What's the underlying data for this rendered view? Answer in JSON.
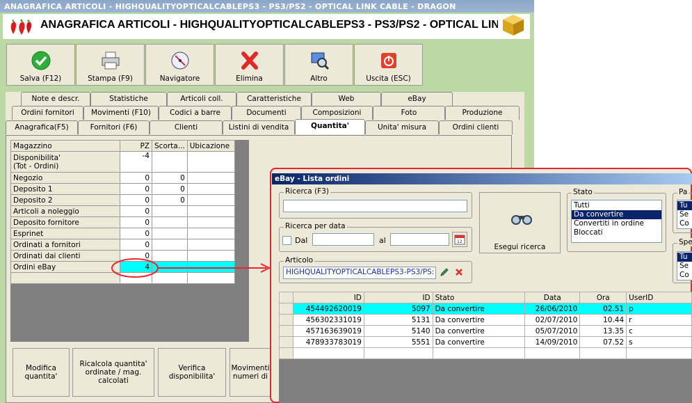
{
  "window": {
    "title": "ANAGRAFICA ARTICOLI - HIGHQUALITYOPTICALCABLEPS3 - PS3/PS2 - OPTICAL LINK CABLE - DRAGON",
    "header": "ANAGRAFICA ARTICOLI - HIGHQUALITYOPTICALCABLEPS3 - PS3/PS2 - OPTICAL LIN"
  },
  "toolbar": [
    {
      "label": "Salva (F12)",
      "icon": "check-icon"
    },
    {
      "label": "Stampa (F9)",
      "icon": "printer-icon"
    },
    {
      "label": "Navigatore",
      "icon": "compass-icon"
    },
    {
      "label": "Elimina",
      "icon": "delete-icon"
    },
    {
      "label": "Altro",
      "icon": "magnifier-icon"
    },
    {
      "label": "Uscita (ESC)",
      "icon": "power-icon"
    }
  ],
  "tabs": {
    "row1": [
      "Note e descr.",
      "Statistiche",
      "Articoli coll.",
      "Caratteristiche",
      "Web",
      "eBay"
    ],
    "row2": [
      "Ordini fornitori",
      "Movimenti (F10)",
      "Codici a barre",
      "Documenti",
      "Composizioni",
      "Foto",
      "Produzione"
    ],
    "row3": [
      "Anagrafica(F5)",
      "Fornitori (F6)",
      "Clienti",
      "Listini di vendita",
      "Quantita'",
      "Unita' misura",
      "Ordini clienti"
    ]
  },
  "stock_grid": {
    "headers": [
      "Magazzino",
      "PZ",
      "Scorta...",
      "Ubicazione"
    ],
    "rows": [
      {
        "label": "Disponibilita'\n(Tot - Ordini)",
        "pz": "-4",
        "scorta": ""
      },
      {
        "label": "Negozio",
        "pz": "0",
        "scorta": "0"
      },
      {
        "label": "Deposito 1",
        "pz": "0",
        "scorta": "0"
      },
      {
        "label": "Deposito 2",
        "pz": "0",
        "scorta": "0"
      },
      {
        "label": "Articoli a noleggio",
        "pz": "0",
        "scorta": ""
      },
      {
        "label": "Deposito fornitore",
        "pz": "0",
        "scorta": ""
      },
      {
        "label": "Esprinet",
        "pz": "0",
        "scorta": ""
      },
      {
        "label": "Ordinati a fornitori",
        "pz": "0",
        "scorta": ""
      },
      {
        "label": "Ordinati dai clienti",
        "pz": "0",
        "scorta": ""
      },
      {
        "label": "Ordini eBay",
        "pz": "4",
        "scorta": ""
      }
    ]
  },
  "bottom_buttons": [
    "Modifica\nquantita'",
    "Ricalcola quantita'\nordinate / mag.\ncalcolati",
    "Verifica\ndisponibilita'",
    "Movimenti\nnumeri di"
  ],
  "ebay": {
    "title": "eBay - Lista ordini",
    "search_label": "Ricerca (F3)",
    "search_value": "",
    "date_label": "Ricerca per data",
    "dal_label": "Dal",
    "al_label": "al",
    "articolo_label": "Articolo",
    "articolo_value": "HIGHQUALITYOPTICALCABLEPS3-PS3/PS:",
    "search_button": "Esegui ricerca",
    "stato_label": "Stato",
    "stato_options": [
      "Tutti",
      "Da convertire",
      "Convertiti in ordine",
      "Bloccati"
    ],
    "stato_selected": 1,
    "pag_label": "Pa",
    "pag_options": [
      "Tu",
      "Se",
      "Co"
    ],
    "spe_label": "Spe",
    "spe_options": [
      "Tu",
      "Se",
      "Co"
    ],
    "orders_headers": [
      "ID",
      "ID",
      "Stato",
      "Data",
      "Ora",
      "UserID"
    ],
    "orders": [
      [
        "454492620019",
        "5097",
        "Da convertire",
        "26/06/2010",
        "02.51",
        "p"
      ],
      [
        "456302331019",
        "5131",
        "Da convertire",
        "02/07/2010",
        "10.44",
        "r"
      ],
      [
        "457163639019",
        "5140",
        "Da convertire",
        "05/07/2010",
        "13.35",
        "c"
      ],
      [
        "478933783019",
        "5551",
        "Da convertire",
        "14/09/2010",
        "07.52",
        "s"
      ]
    ]
  },
  "colors": {
    "highlight": "#00ffff",
    "annotation": "#e8252e",
    "window_bg": "#bcd8a4",
    "panel_bg": "#ece9d8"
  }
}
